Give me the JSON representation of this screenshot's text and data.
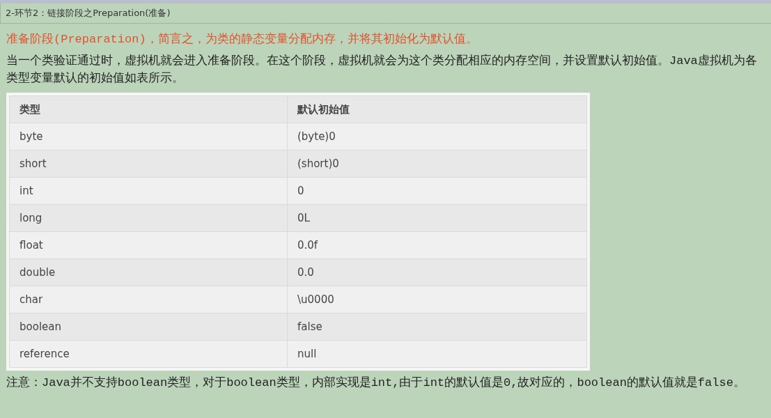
{
  "section_title": "2-环节2：链接阶段之Preparation(准备)",
  "highlight": "准备阶段(Preparation)，简言之，为类的静态变量分配内存，并将其初始化为默认值。",
  "intro": "当一个类验证通过时，虚拟机就会进入准备阶段。在这个阶段，虚拟机就会为这个类分配相应的内存空间，并设置默认初始值。Java虚拟机为各类型变量默认的初始值如表所示。",
  "table": {
    "columns": [
      "类型",
      "默认初始值"
    ],
    "rows": [
      [
        "byte",
        "(byte)0"
      ],
      [
        "short",
        "(short)0"
      ],
      [
        "int",
        "0"
      ],
      [
        "long",
        "0L"
      ],
      [
        "float",
        "0.0f"
      ],
      [
        "double",
        "0.0"
      ],
      [
        "char",
        "\\u0000"
      ],
      [
        "boolean",
        "false"
      ],
      [
        "reference",
        "null"
      ]
    ]
  },
  "note": "注意：Java并不支持boolean类型，对于boolean类型，内部实现是int,由于int的默认值是0,故对应的，boolean的默认值就是false。"
}
